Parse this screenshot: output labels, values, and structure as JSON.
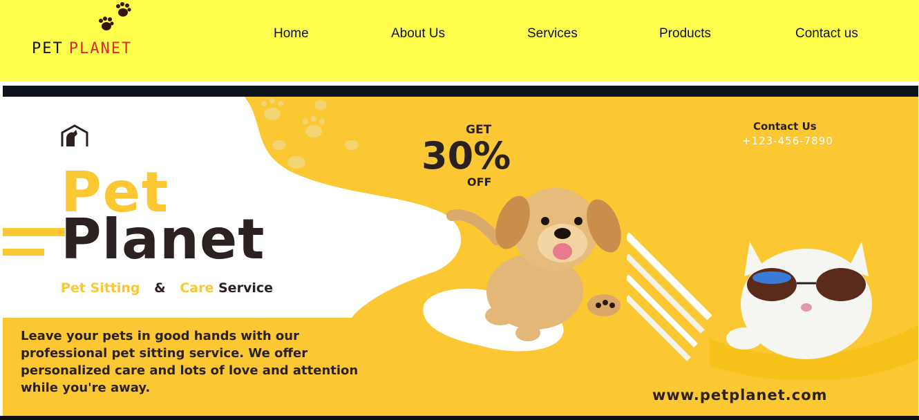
{
  "header": {
    "logo": {
      "word1": "PET",
      "word2": "PLANET"
    },
    "nav": [
      "Home",
      "About Us",
      "Services",
      "Products",
      "Contact us"
    ]
  },
  "banner": {
    "title_line1": "Pet",
    "title_line2": "Planet",
    "tagline": {
      "part1": "Pet Sitting",
      "amp": "&",
      "part2": "Care",
      "part3": "Service"
    },
    "description": "Leave your pets in good hands with our professional pet sitting service. We offer personalized care and lots of love and attention while you're away.",
    "offer": {
      "get": "GET",
      "percent": "30%",
      "off": "OFF"
    },
    "contact": {
      "title": "Contact Us",
      "phone": "+123-456-7890"
    },
    "website": "www.petplanet.com"
  },
  "colors": {
    "header_bg": "#ffff4d",
    "banner_bg": "#fbc733",
    "dark_text": "#2a2120",
    "logo_red": "#e8262a"
  }
}
